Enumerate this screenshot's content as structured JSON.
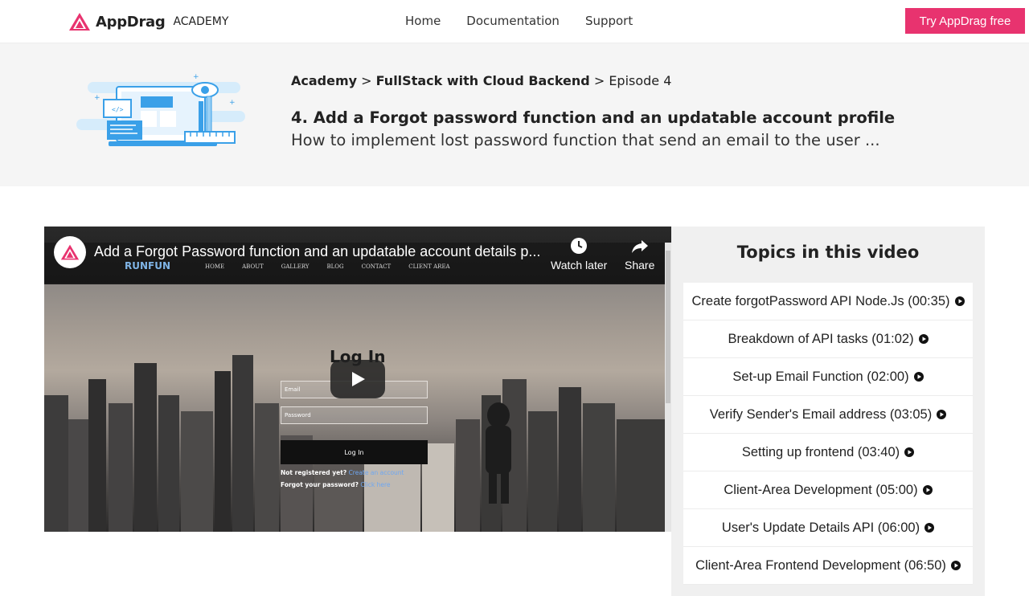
{
  "header": {
    "brand": "AppDrag",
    "brand_sub": "ACADEMY",
    "nav": [
      "Home",
      "Documentation",
      "Support"
    ],
    "cta": "Try AppDrag free"
  },
  "hero": {
    "breadcrumb": {
      "root": "Academy",
      "sep1": ">",
      "course": "FullStack with Cloud Backend",
      "sep2": ">",
      "episode": "Episode 4"
    },
    "title": "4. Add a Forgot password function and an updatable account profile",
    "description": "How to implement lost password function that send an email to the user ..."
  },
  "video": {
    "title": "Add a Forgot Password function and an updatable account details p...",
    "watch_later": "Watch later",
    "share": "Share",
    "site_brand": "RUNFUN",
    "site_links": [
      "HOME",
      "ABOUT",
      "GALLERY",
      "BLOG",
      "CONTACT",
      "CLIENT AREA"
    ],
    "login_title": "Log In",
    "email_label": "Email",
    "password_label": "Password",
    "login_button": "Log In",
    "not_registered": "Not registered yet?",
    "create_account": "Create an account",
    "forgot": "Forgot your password?",
    "click_here": "Click here"
  },
  "topics": {
    "title": "Topics in this video",
    "items": [
      "Create forgotPassword API Node.Js (00:35)",
      "Breakdown of API tasks (01:02)",
      "Set-up Email Function (02:00)",
      "Verify Sender's Email address (03:05)",
      "Setting up frontend (03:40)",
      "Client-Area Development (05:00)",
      "User's Update Details API (06:00)",
      "Client-Area Frontend Development (06:50)"
    ]
  },
  "colors": {
    "accent": "#e8336f",
    "hero_bg": "#f5f5f5",
    "panel_bg": "#f0f0f0",
    "illustration_blue": "#3aa0e8"
  }
}
